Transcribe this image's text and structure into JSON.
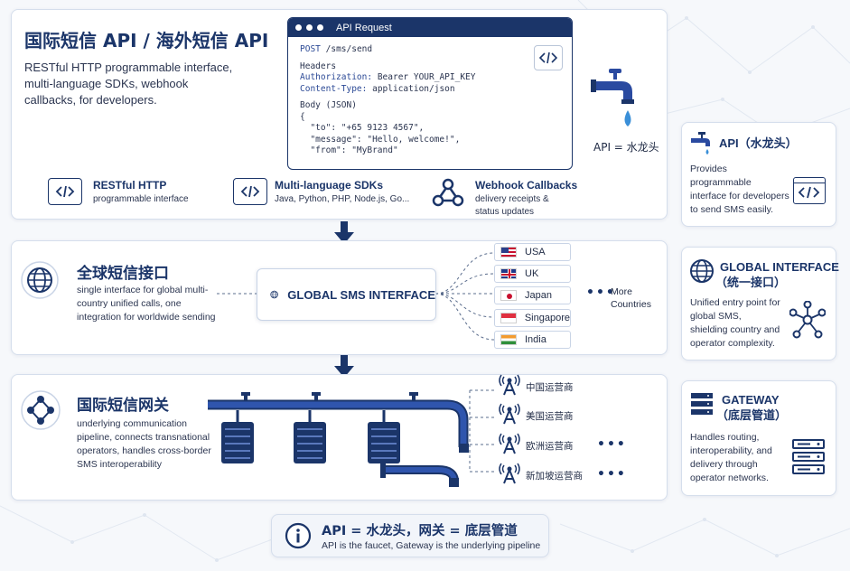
{
  "header": {
    "title": "国际短信 API / 海外短信 API",
    "description": "RESTful HTTP programmable interface, multi-language SDKs, webhook callbacks, for developers."
  },
  "api_request": {
    "window_title": "API Request",
    "method": "POST",
    "path": "/sms/send",
    "headers_label": "Headers",
    "auth_key": "Authorization:",
    "auth_value": "Bearer YOUR_API_KEY",
    "ct_key": "Content-Type:",
    "ct_value": "application/json",
    "body_label": "Body (JSON)",
    "open_brace": "{",
    "to_line": "  \"to\": \"+65 9123 4567\",",
    "message_line": "  \"message\": \"Hello, welcome!\",",
    "from_line": "  \"from\": \"MyBrand\""
  },
  "faucet_caption": "API = 水龙头",
  "features": [
    {
      "title": "RESTful HTTP",
      "subtitle": "programmable interface",
      "icon": "code-icon"
    },
    {
      "title": "Multi-language SDKs",
      "subtitle": "Java, Python, PHP, Node.js, Go...",
      "icon": "code-icon"
    },
    {
      "title": "Webhook Callbacks",
      "subtitle": "delivery receipts & status updates",
      "icon": "webhook-icon"
    }
  ],
  "interface": {
    "title": "全球短信接口",
    "description": "single interface for global multi-country unified calls, one integration for worldwide sending",
    "center_label": "GLOBAL SMS INTERFACE",
    "countries": [
      "USA",
      "UK",
      "Japan",
      "Singapore",
      "India"
    ],
    "more": "More Countries"
  },
  "gateway": {
    "title": "国际短信网关",
    "description": "underlying communication pipeline, connects transnational operators, handles cross-border SMS interoperability",
    "carriers": [
      "中国运营商",
      "美国运营商",
      "欧洲运营商",
      "新加坡运营商"
    ]
  },
  "side_cards": [
    {
      "title": "API（水龙头）",
      "title2": "",
      "description": "Provides programmable interface for developers to send SMS easily."
    },
    {
      "title": "GLOBAL INTERFACE",
      "title2": "（统一接口）",
      "description": "Unified entry point for global SMS, shielding country and operator complexity."
    },
    {
      "title": "GATEWAY",
      "title2": "（底层管道）",
      "description": "Handles routing, interoperability, and delivery through operator networks."
    }
  ],
  "summary": {
    "title": "API = 水龙头，网关 = 底层管道",
    "subtitle": "API is the faucet, Gateway is the underlying pipeline"
  },
  "colors": {
    "navy": "#1b3569",
    "pipe": "#2a4aa0",
    "water": "#3a8fd8"
  }
}
